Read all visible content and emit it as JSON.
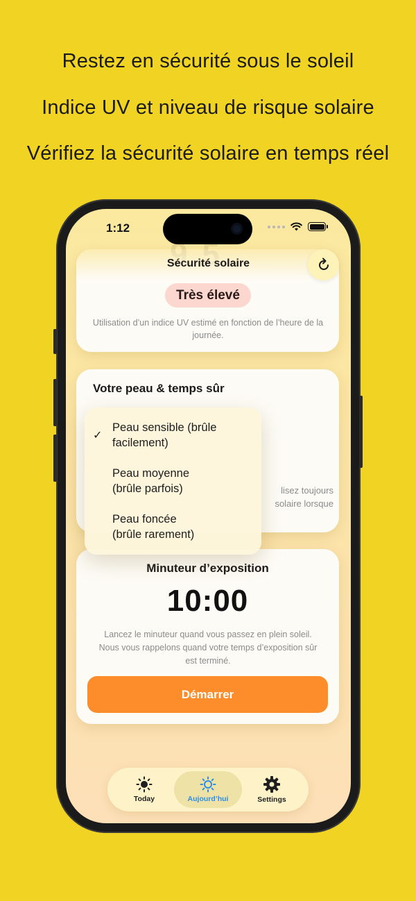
{
  "promo": {
    "line1": "Restez en sécurité sous le soleil",
    "line2": "Indice UV et niveau de risque solaire",
    "line3": "Vérifiez la sécurité solaire en temps réel"
  },
  "status_bar": {
    "time": "1:12"
  },
  "nav": {
    "title": "Sécurité solaire",
    "refresh_icon": "refresh-icon"
  },
  "uv_card": {
    "risk_level": "Très élevé",
    "note": "Utilisation d’un indice UV estimé en fonction de l’heure de la journée."
  },
  "skin_card": {
    "title": "Votre peau & temps sûr",
    "tip_line1": "lisez toujours",
    "tip_line2": "solaire lorsque"
  },
  "skin_menu": {
    "items": [
      {
        "label_line1": "Peau sensible (brûle",
        "label_line2": "facilement)",
        "selected": true
      },
      {
        "label_line1": "Peau moyenne",
        "label_line2": "(brûle parfois)",
        "selected": false
      },
      {
        "label_line1": "Peau foncée",
        "label_line2": "(brûle rarement)",
        "selected": false
      }
    ],
    "check_glyph": "✓"
  },
  "timer_card": {
    "title": "Minuteur d’exposition",
    "value": "10:00",
    "note": "Lancez le minuteur quand vous passez en plein soleil. Nous vous rappelons quand votre temps d’exposition sûr est terminé.",
    "start_label": "Démarrer"
  },
  "tabs": [
    {
      "label": "Today",
      "icon": "sun-icon",
      "active": false
    },
    {
      "label": "Aujourd’hui",
      "icon": "sun-icon",
      "active": true
    },
    {
      "label": "Settings",
      "icon": "gear-icon",
      "active": false
    }
  ],
  "colors": {
    "background": "#f1d323",
    "accent_orange": "#fd8c2a",
    "risk_pill": "#fbd7cf",
    "active_tab": "#2b8fe6"
  }
}
